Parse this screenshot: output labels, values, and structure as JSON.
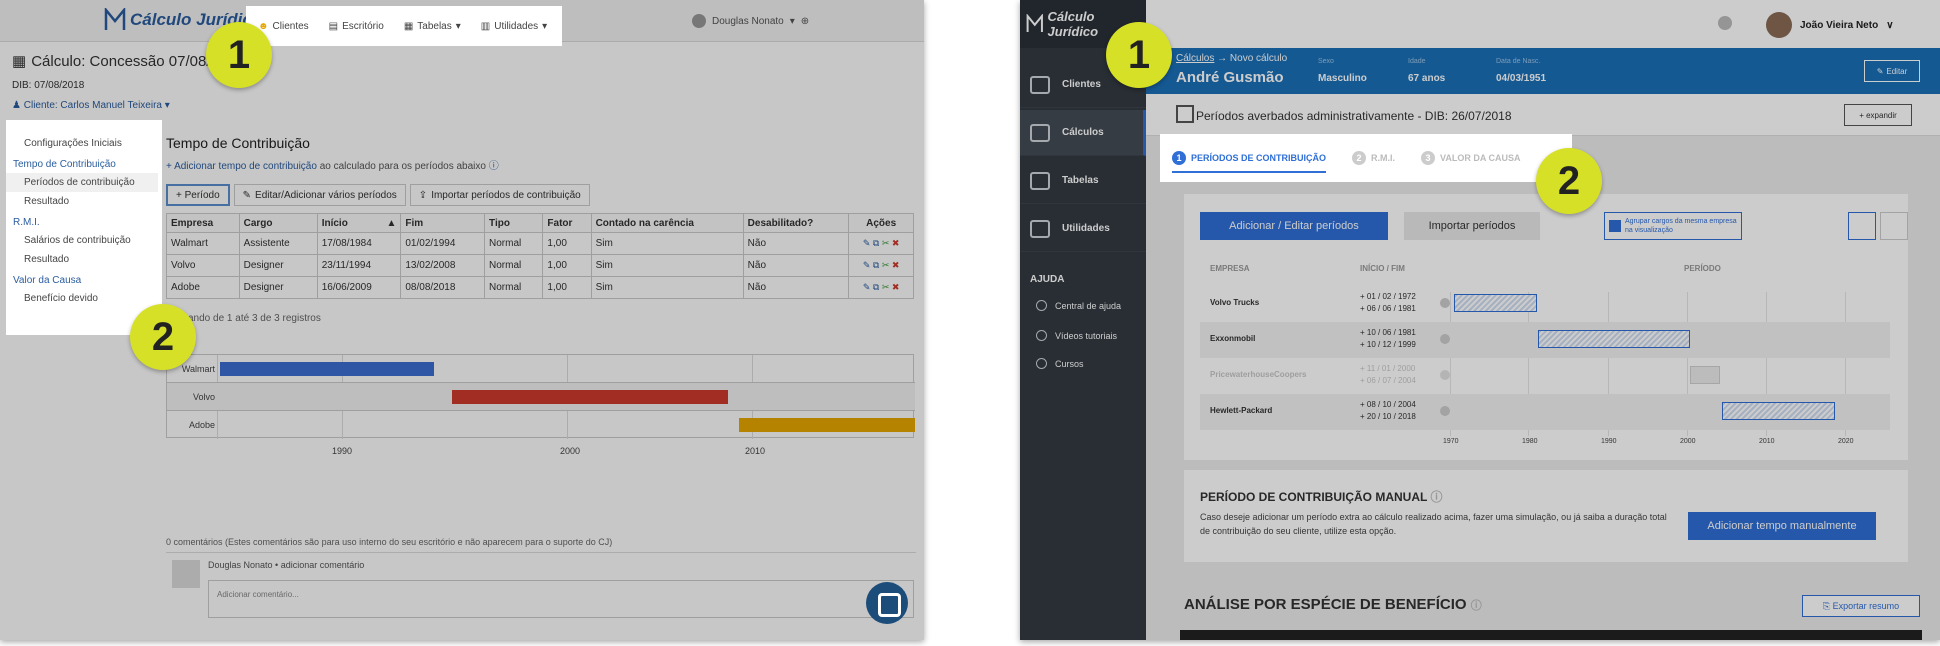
{
  "left": {
    "logo": "Cálculo Jurídico",
    "nav": [
      "Clientes",
      "Escritório",
      "Tabelas",
      "Utilidades"
    ],
    "user": "Douglas Nonato",
    "page_title": "Cálculo: Concessão 07/08/2",
    "dib": "DIB: 07/08/2018",
    "client": "Cliente: Carlos Manuel Teixeira",
    "sidebar": {
      "config": "Configurações Iniciais",
      "tempo_head": "Tempo de Contribuição",
      "periodos": "Períodos de contribuição",
      "resultado1": "Resultado",
      "rmi_head": "R.M.I.",
      "salarios": "Salários de contribuição",
      "resultado2": "Resultado",
      "valor_head": "Valor da Causa",
      "beneficio": "Benefício devido"
    },
    "main_title": "Tempo de Contribuição",
    "add_link": "+ Adicionar tempo de contribuição",
    "add_rest": " ao calculado para os períodos abaixo",
    "buttons": {
      "periodo": "+ Período",
      "editar": "Editar/Adicionar vários períodos",
      "importar": "Importar períodos de contribuição"
    },
    "table_headers": [
      "Empresa",
      "Cargo",
      "Início",
      "Fim",
      "Tipo",
      "Fator",
      "Contado na carência",
      "Desabilitado?",
      "Ações"
    ],
    "rows": [
      [
        "Walmart",
        "Assistente",
        "17/08/1984",
        "01/02/1994",
        "Normal",
        "1,00",
        "Sim",
        "Não"
      ],
      [
        "Volvo",
        "Designer",
        "23/11/1994",
        "13/02/2008",
        "Normal",
        "1,00",
        "Sim",
        "Não"
      ],
      [
        "Adobe",
        "Designer",
        "16/06/2009",
        "08/08/2018",
        "Normal",
        "1,00",
        "Sim",
        "Não"
      ]
    ],
    "count": "ando de 1 até 3 de 3 registros",
    "gantt_labels": [
      "Walmart",
      "Volvo",
      "Adobe"
    ],
    "gantt_colors": [
      "#3b6fd4",
      "#d03a2e",
      "#e8a800"
    ],
    "gantt_axis": [
      "1990",
      "2000",
      "2010"
    ],
    "comments": "0 comentários   (Estes comentários são para uso interno do seu escritório e não aparecem para o suporte do CJ)",
    "comment_user": "Douglas Nonato  •  adicionar comentário",
    "comment_placeholder": "Adicionar comentário..."
  },
  "badges": {
    "one": "1",
    "two": "2"
  },
  "right": {
    "logo": "Cálculo Jurídico",
    "nav": [
      "Clientes",
      "Cálculos",
      "Tabelas",
      "Utilidades"
    ],
    "help_head": "AJUDA",
    "help": [
      "Central de ajuda",
      "Vídeos tutoriais",
      "Cursos"
    ],
    "user": "João Vieira Neto",
    "breadcrumb_link": "Cálculos",
    "breadcrumb_rest": "→  Novo cálculo",
    "client_name": "André Gusmão",
    "meta_labels": [
      "Sexo",
      "Idade",
      "Data de Nasc."
    ],
    "meta_values": [
      "Masculino",
      "67 anos",
      "04/03/1951"
    ],
    "edit": "Editar",
    "sub_title": "Períodos averbados administrativamente - DIB: 26/07/2018",
    "expand": "+ expandir",
    "tabs": [
      {
        "n": "1",
        "label": "PERÍODOS DE CONTRIBUIÇÃO"
      },
      {
        "n": "2",
        "label": "R.M.I."
      },
      {
        "n": "3",
        "label": "VALOR DA CAUSA"
      }
    ],
    "btn_primary": "Adicionar / Editar períodos",
    "btn_secondary": "Importar períodos",
    "group_label": "Agrupar cargos da mesma empresa na visualização",
    "headers": [
      "EMPRESA",
      "INÍCIO / FIM",
      "PERÍODO"
    ],
    "companies": [
      {
        "name": "Volvo Trucks",
        "start": "+ 01 / 02 / 1972",
        "end": "+ 06 / 06 / 1981"
      },
      {
        "name": "Exxonmobil",
        "start": "+ 10 / 06 / 1981",
        "end": "+ 10 / 12 / 1999"
      },
      {
        "name": "PricewaterhouseCoopers",
        "start": "+ 11 / 01 / 2000",
        "end": "+ 06 / 07 / 2004"
      },
      {
        "name": "Hewlett-Packard",
        "start": "+ 08 / 10 / 2004",
        "end": "+ 20 / 10 / 2018"
      }
    ],
    "axis": [
      "1970",
      "1980",
      "1990",
      "2000",
      "2010",
      "2020"
    ],
    "manual_title": "PERÍODO DE CONTRIBUIÇÃO MANUAL",
    "manual_desc": "Caso deseje adicionar um período extra ao cálculo realizado acima, fazer uma simulação, ou já saiba a duração total de contribuição do seu cliente, utilize esta opção.",
    "manual_btn": "Adicionar tempo manualmente",
    "analysis": "ANÁLISE POR ESPÉCIE DE BENEFÍCIO",
    "export": "Exportar resumo"
  }
}
